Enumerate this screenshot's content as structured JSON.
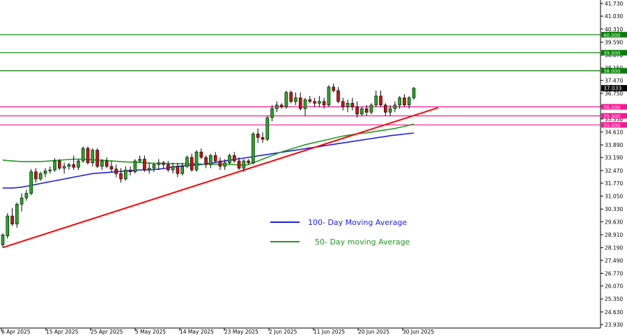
{
  "chart_data": {
    "type": "candlestick",
    "y_axis": {
      "ticks": [
        "41.730",
        "41.030",
        "40.310",
        "39.590",
        "38.870",
        "38.150",
        "37.470",
        "36.750",
        "36.030",
        "35.330",
        "34.610",
        "33.890",
        "33.190",
        "32.470",
        "31.770",
        "31.050",
        "30.330",
        "29.630",
        "28.910",
        "28.190",
        "27.490",
        "26.770",
        "26.070",
        "25.350",
        "24.630",
        "23.930"
      ],
      "range": [
        23.93,
        41.73
      ]
    },
    "x_axis": {
      "labels": [
        "6 Apr 2025",
        "15 Apr 2025",
        "25 Apr 2025",
        "5 May 2025",
        "14 May 2025",
        "23 May 2025",
        "2 Jun 2025",
        "11 Jun 2025",
        "20 Jun 2025",
        "30 Jun 2025"
      ]
    },
    "last_price": "37.033",
    "horizontal_levels": [
      {
        "value": 40.0,
        "label": "40.000",
        "color": "#008000"
      },
      {
        "value": 39.0,
        "label": "39.000",
        "color": "#008000"
      },
      {
        "value": 38.0,
        "label": "38.000",
        "color": "#008000"
      },
      {
        "value": 36.0,
        "label": "36.000",
        "color": "#ff1493"
      },
      {
        "value": 35.5,
        "label": "35.500",
        "color": "#ff1493"
      },
      {
        "value": 35.0,
        "label": "35.000",
        "color": "#ff1493"
      }
    ],
    "trendline": {
      "from": [
        0,
        28.2
      ],
      "to": [
        88,
        35.75
      ],
      "color": "#ff0000"
    },
    "candles": [
      [
        28.35,
        29.0,
        28.2,
        28.9
      ],
      [
        28.85,
        30.1,
        28.7,
        29.95
      ],
      [
        29.95,
        30.4,
        29.4,
        29.5
      ],
      [
        29.5,
        30.7,
        29.3,
        30.6
      ],
      [
        30.6,
        31.2,
        30.2,
        30.95
      ],
      [
        30.95,
        31.4,
        30.8,
        31.2
      ],
      [
        31.2,
        32.55,
        31.1,
        32.4
      ],
      [
        32.4,
        32.6,
        31.8,
        32.0
      ],
      [
        32.0,
        32.4,
        31.9,
        32.3
      ],
      [
        32.3,
        32.6,
        32.1,
        32.45
      ],
      [
        32.45,
        32.7,
        32.3,
        32.5
      ],
      [
        32.5,
        33.15,
        32.4,
        33.0
      ],
      [
        33.0,
        33.1,
        32.5,
        32.6
      ],
      [
        32.6,
        32.9,
        32.3,
        32.7
      ],
      [
        32.7,
        32.9,
        32.5,
        32.8
      ],
      [
        32.8,
        33.3,
        32.5,
        32.65
      ],
      [
        32.65,
        33.1,
        32.5,
        33.0
      ],
      [
        33.0,
        33.8,
        32.9,
        33.7
      ],
      [
        33.7,
        33.8,
        32.8,
        32.9
      ],
      [
        32.9,
        33.7,
        32.7,
        33.6
      ],
      [
        33.6,
        33.7,
        32.6,
        32.7
      ],
      [
        32.7,
        33.1,
        32.5,
        33.0
      ],
      [
        33.0,
        33.2,
        32.6,
        32.7
      ],
      [
        32.7,
        33.0,
        32.4,
        32.55
      ],
      [
        32.55,
        32.8,
        32.1,
        32.3
      ],
      [
        32.3,
        32.6,
        31.8,
        32.0
      ],
      [
        32.0,
        32.7,
        31.9,
        32.5
      ],
      [
        32.5,
        32.7,
        32.2,
        32.4
      ],
      [
        32.4,
        33.1,
        32.3,
        33.0
      ],
      [
        33.0,
        33.3,
        32.9,
        33.1
      ],
      [
        33.1,
        33.3,
        32.4,
        32.5
      ],
      [
        32.5,
        32.9,
        32.3,
        32.6
      ],
      [
        32.6,
        32.9,
        32.4,
        32.8
      ],
      [
        32.8,
        33.1,
        32.5,
        32.9
      ],
      [
        32.9,
        33.0,
        32.6,
        32.8
      ],
      [
        32.8,
        33.0,
        32.4,
        32.5
      ],
      [
        32.5,
        32.9,
        32.3,
        32.7
      ],
      [
        32.7,
        32.9,
        32.1,
        32.3
      ],
      [
        32.3,
        32.9,
        32.2,
        32.7
      ],
      [
        32.7,
        33.3,
        32.6,
        33.2
      ],
      [
        33.2,
        33.4,
        32.4,
        32.5
      ],
      [
        32.5,
        33.6,
        32.4,
        33.5
      ],
      [
        33.5,
        33.7,
        33.1,
        33.2
      ],
      [
        33.2,
        33.3,
        32.6,
        32.8
      ],
      [
        32.8,
        33.4,
        32.6,
        33.3
      ],
      [
        33.3,
        33.5,
        32.9,
        33.0
      ],
      [
        33.0,
        33.2,
        32.5,
        32.7
      ],
      [
        32.7,
        33.1,
        32.5,
        32.9
      ],
      [
        32.9,
        33.4,
        32.8,
        33.3
      ],
      [
        33.3,
        33.5,
        32.9,
        33.0
      ],
      [
        33.0,
        33.2,
        32.5,
        32.6
      ],
      [
        32.6,
        33.1,
        32.4,
        33.0
      ],
      [
        33.0,
        33.1,
        32.8,
        32.9
      ],
      [
        32.9,
        34.6,
        32.8,
        34.5
      ],
      [
        34.5,
        34.8,
        34.0,
        34.3
      ],
      [
        34.3,
        34.6,
        34.0,
        34.2
      ],
      [
        34.2,
        35.5,
        34.1,
        35.4
      ],
      [
        35.4,
        36.1,
        35.2,
        35.9
      ],
      [
        35.9,
        36.3,
        35.7,
        36.1
      ],
      [
        36.1,
        36.2,
        35.9,
        36.0
      ],
      [
        36.0,
        36.9,
        35.9,
        36.8
      ],
      [
        36.8,
        36.9,
        36.2,
        36.3
      ],
      [
        36.3,
        36.8,
        36.1,
        36.5
      ],
      [
        36.5,
        36.8,
        35.8,
        35.9
      ],
      [
        35.9,
        36.5,
        35.5,
        36.4
      ],
      [
        36.4,
        36.6,
        36.2,
        36.3
      ],
      [
        36.3,
        36.5,
        36.0,
        36.2
      ],
      [
        36.2,
        36.6,
        36.0,
        36.3
      ],
      [
        36.3,
        36.5,
        35.9,
        36.1
      ],
      [
        36.1,
        37.2,
        36.0,
        37.1
      ],
      [
        37.1,
        37.3,
        36.8,
        36.9
      ],
      [
        36.9,
        37.1,
        36.2,
        36.3
      ],
      [
        36.3,
        36.5,
        35.8,
        36.0
      ],
      [
        36.0,
        36.4,
        35.7,
        36.2
      ],
      [
        36.2,
        36.5,
        35.8,
        36.0
      ],
      [
        36.0,
        36.3,
        35.4,
        35.6
      ],
      [
        35.6,
        36.0,
        35.5,
        35.9
      ],
      [
        35.9,
        36.1,
        35.5,
        35.7
      ],
      [
        35.7,
        36.2,
        35.6,
        36.1
      ],
      [
        36.1,
        36.9,
        36.0,
        36.6
      ],
      [
        36.6,
        36.9,
        36.0,
        36.1
      ],
      [
        36.1,
        36.2,
        35.5,
        35.7
      ],
      [
        35.7,
        36.1,
        35.5,
        35.9
      ],
      [
        35.9,
        36.3,
        35.7,
        36.1
      ],
      [
        36.1,
        36.6,
        35.9,
        36.5
      ],
      [
        36.5,
        36.7,
        36.0,
        36.1
      ],
      [
        36.1,
        36.6,
        35.9,
        36.5
      ],
      [
        36.5,
        37.1,
        36.4,
        37.033
      ]
    ],
    "series": [
      {
        "name": "100- Day Moving Average",
        "color": "#1e1ee6",
        "values": [
          31.5,
          31.5,
          31.5,
          31.52,
          31.55,
          31.6,
          31.65,
          31.7,
          31.75,
          31.8,
          31.85,
          31.9,
          31.95,
          32.0,
          32.05,
          32.1,
          32.15,
          32.2,
          32.25,
          32.3,
          32.32,
          32.34,
          32.36,
          32.38,
          32.4,
          32.42,
          32.44,
          32.46,
          32.48,
          32.5,
          32.5,
          32.5,
          32.52,
          32.55,
          32.58,
          32.62,
          32.66,
          32.7,
          32.72,
          32.74,
          32.76,
          32.78,
          32.8,
          32.84,
          32.88,
          32.92,
          32.96,
          33.0,
          33.04,
          33.08,
          33.12,
          33.16,
          33.2,
          33.24,
          33.28,
          33.32,
          33.36,
          33.4,
          33.44,
          33.48,
          33.52,
          33.56,
          33.6,
          33.64,
          33.68,
          33.72,
          33.76,
          33.8,
          33.84,
          33.88,
          33.92,
          33.96,
          34.0,
          34.04,
          34.08,
          34.12,
          34.16,
          34.2,
          34.24,
          34.28,
          34.32,
          34.36,
          34.4,
          34.43,
          34.46,
          34.49,
          34.52,
          34.55
        ]
      },
      {
        "name": "50- Day moving Average",
        "color": "#1f9a1f",
        "values": [
          33.05,
          33.02,
          33.0,
          32.98,
          32.97,
          32.96,
          32.96,
          32.96,
          32.97,
          32.98,
          33.0,
          33.02,
          33.04,
          33.06,
          33.08,
          33.1,
          33.1,
          33.1,
          33.08,
          33.06,
          33.05,
          33.04,
          33.02,
          33.0,
          32.98,
          32.96,
          32.95,
          32.94,
          32.93,
          32.92,
          32.9,
          32.88,
          32.87,
          32.86,
          32.86,
          32.86,
          32.85,
          32.85,
          32.85,
          32.85,
          32.85,
          32.84,
          32.83,
          32.82,
          32.82,
          32.82,
          32.82,
          32.82,
          32.82,
          32.8,
          32.78,
          32.76,
          32.8,
          32.9,
          33.0,
          33.1,
          33.2,
          33.3,
          33.4,
          33.5,
          33.58,
          33.66,
          33.74,
          33.82,
          33.9,
          33.96,
          34.02,
          34.08,
          34.14,
          34.2,
          34.26,
          34.32,
          34.38,
          34.42,
          34.46,
          34.5,
          34.53,
          34.56,
          34.6,
          34.64,
          34.68,
          34.72,
          34.76,
          34.8,
          34.86,
          34.92,
          34.98,
          35.05
        ]
      }
    ],
    "legend": [
      {
        "label": "100- Day Moving Average",
        "color": "#1e1ee6"
      },
      {
        "label": "50- Day moving Average",
        "color": "#1f9a1f"
      }
    ],
    "colors": {
      "up": "#22aa22",
      "down": "#cc1111",
      "axis": "#000000"
    }
  }
}
